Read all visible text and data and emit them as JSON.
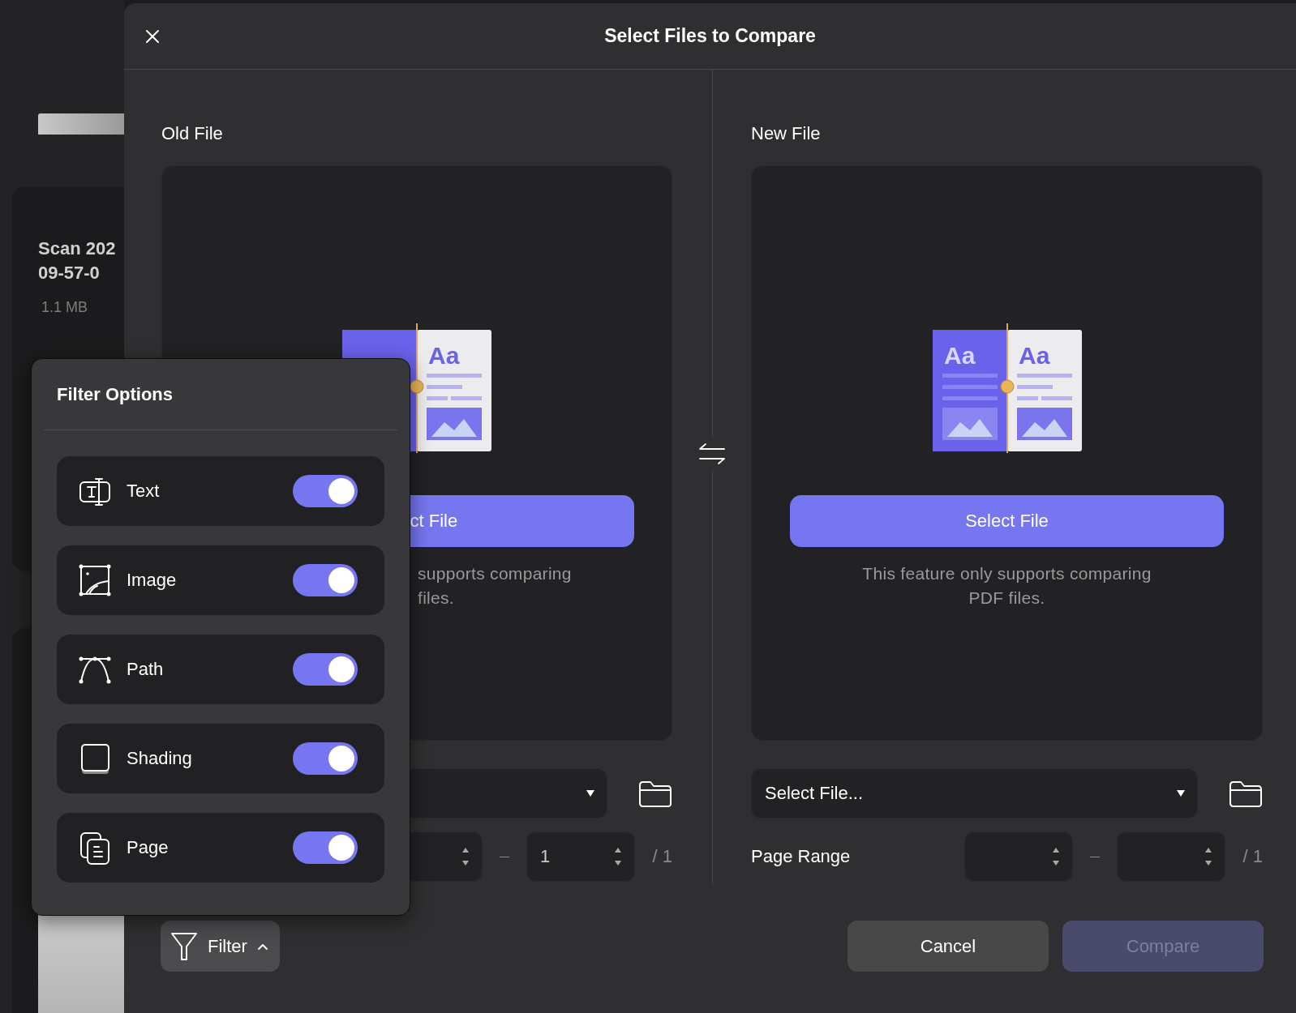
{
  "background_app": {
    "file_card": {
      "name_lines": [
        "Scan 202",
        "09-57-0"
      ],
      "size": "1.1 MB"
    }
  },
  "dialog": {
    "title": "Select Files to Compare",
    "panels": [
      {
        "heading": "Old File",
        "illustration_labels": {
          "right": "Aa"
        },
        "select_button": "ct File",
        "note_lines": [
          "supports comparing",
          "files."
        ],
        "page_range": {
          "to": "1",
          "total": "/ 1"
        }
      },
      {
        "heading": "New File",
        "illustration_labels": {
          "left": "Aa",
          "right": "Aa"
        },
        "select_button": "Select File",
        "note_lines": [
          "This feature only supports comparing",
          "PDF files."
        ],
        "file_dropdown": {
          "value": "Select File..."
        },
        "page_range": {
          "label": "Page Range",
          "total": "/ 1"
        }
      }
    ],
    "filter_button": {
      "label": "Filter",
      "expanded": true
    },
    "footer_buttons": [
      {
        "label": "Cancel",
        "disabled": false
      },
      {
        "label": "Compare",
        "disabled": true
      }
    ]
  },
  "filter_popover": {
    "title": "Filter Options",
    "options": [
      {
        "label": "Text",
        "kind": "text",
        "on": true
      },
      {
        "label": "Image",
        "kind": "image",
        "on": true
      },
      {
        "label": "Path",
        "kind": "path",
        "on": true
      },
      {
        "label": "Shading",
        "kind": "shading",
        "on": true
      },
      {
        "label": "Page",
        "kind": "page",
        "on": true
      }
    ]
  }
}
